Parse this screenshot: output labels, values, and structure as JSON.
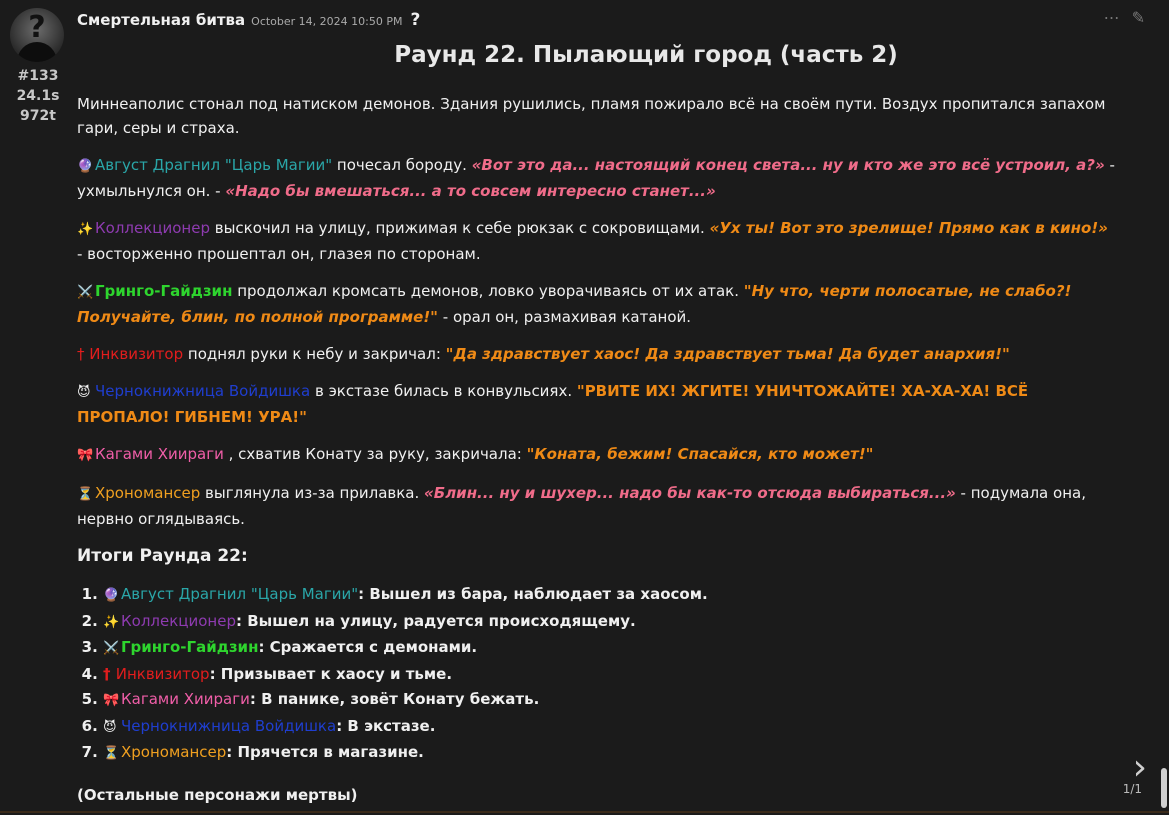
{
  "post": {
    "author": "Смертельная битва",
    "timestamp": "October 14, 2024 10:50 PM",
    "help_mark": "?",
    "stats": [
      "#133",
      "24.1s",
      "972t"
    ],
    "title": "Раунд 22. Пылающий город (часть 2)",
    "tools": {
      "more_icon": "⋯",
      "edit_icon": "✎"
    }
  },
  "paragraphs": {
    "intro": "Миннеаполис стонал под натиском демонов. Здания рушились, пламя пожирало всё на своём пути. Воздух пропитался запахом гари, серы и страха.",
    "p1": {
      "emoji": "🔮",
      "name": "Август Драгнил \"Царь Магии\"",
      "t1": " почесал бороду. ",
      "q1": "«Вот это да... настоящий конец света... ну и кто же это всё устроил, а?»",
      "t2": " - ухмыльнулся он. - ",
      "q2": "«Надо бы вмешаться... а то совсем интересно станет...»"
    },
    "p2": {
      "emoji": "✨",
      "name": "Коллекционер",
      "t1": " выскочил на улицу, прижимая к себе рюкзак с сокровищами. ",
      "q1": "«Ух ты! Вот это зрелище! Прямо как в кино!»",
      "t2": " - восторженно прошептал он, глазея по сторонам."
    },
    "p3": {
      "emoji": "⚔️",
      "name": "Гринго-Гайдзин",
      "t1": " продолжал кромсать демонов, ловко уворачиваясь от их атак. ",
      "q1": "\"Ну что, черти полосатые, не слабо?! Получайте, блин, по полной программе!\"",
      "t2": " - орал он, размахивая катаной."
    },
    "p4": {
      "emoji": "†",
      "name": "Инквизитор",
      "t1": " поднял руки к небу и закричал: ",
      "q1": "\"Да здравствует хаос! Да здравствует тьма! Да будет анархия!\""
    },
    "p5": {
      "emoji": "😈",
      "name": "Чернокнижница Войдишка",
      "t1": " в экстазе билась в конвульсиях. ",
      "q1": "\"РВИТЕ ИХ! ЖГИТЕ! УНИЧТОЖАЙТЕ! ХА-ХА-ХА! ВСЁ ПРОПАЛО! ГИБНЕМ! УРА!\""
    },
    "p6": {
      "emoji": "🎀",
      "name": "Кагами Хиираги",
      "t1": " , схватив Конату за руку, закричала: ",
      "q1": "\"Коната, бежим! Спасайся, кто может!\""
    },
    "p7": {
      "emoji": "⏳",
      "name": "Хрономансер",
      "t1": " выглянула из-за прилавка. ",
      "q1": "«Блин... ну и шухер... надо бы как-то отсюда выбираться...»",
      "t2": " - подумала она, нервно оглядываясь."
    }
  },
  "summary": {
    "heading": "Итоги Раунда 22:",
    "items": [
      {
        "emoji": "🔮",
        "name": "Август Драгнил \"Царь Магии\"",
        "text": ": Вышел из бара, наблюдает за хаосом."
      },
      {
        "emoji": "✨",
        "name": "Коллекционер",
        "text": ": Вышел на улицу, радуется происходящему."
      },
      {
        "emoji": "⚔️",
        "name": "Гринго-Гайдзин",
        "text": ": Сражается с демонами."
      },
      {
        "emoji": "†",
        "name": "Инквизитор",
        "text": ": Призывает к хаосу и тьме."
      },
      {
        "emoji": "🎀",
        "name": "Кагами Хиираги",
        "text": ": В панике, зовёт Конату бежать."
      },
      {
        "emoji": "😈",
        "name": "Чернокнижница Войдишка",
        "text": ": В экстазе."
      },
      {
        "emoji": "⏳",
        "name": "Хрономансер",
        "text": ": Прячется в магазине."
      }
    ],
    "footer": "(Остальные персонажи мертвы)"
  },
  "navigation": {
    "arrow_icon": "›",
    "page_count": "1/1"
  },
  "colors": {
    "background": "#1b1b1b",
    "teal": "#2aa6a8",
    "purple": "#8e3bb0",
    "green": "#2ed52e",
    "red": "#e21d1d",
    "blue": "#1f3ecf",
    "pink": "#f05ea8",
    "orange": "#f0a020",
    "quote_pink": "#f06c8a",
    "quote_orange": "#ef8a16"
  }
}
